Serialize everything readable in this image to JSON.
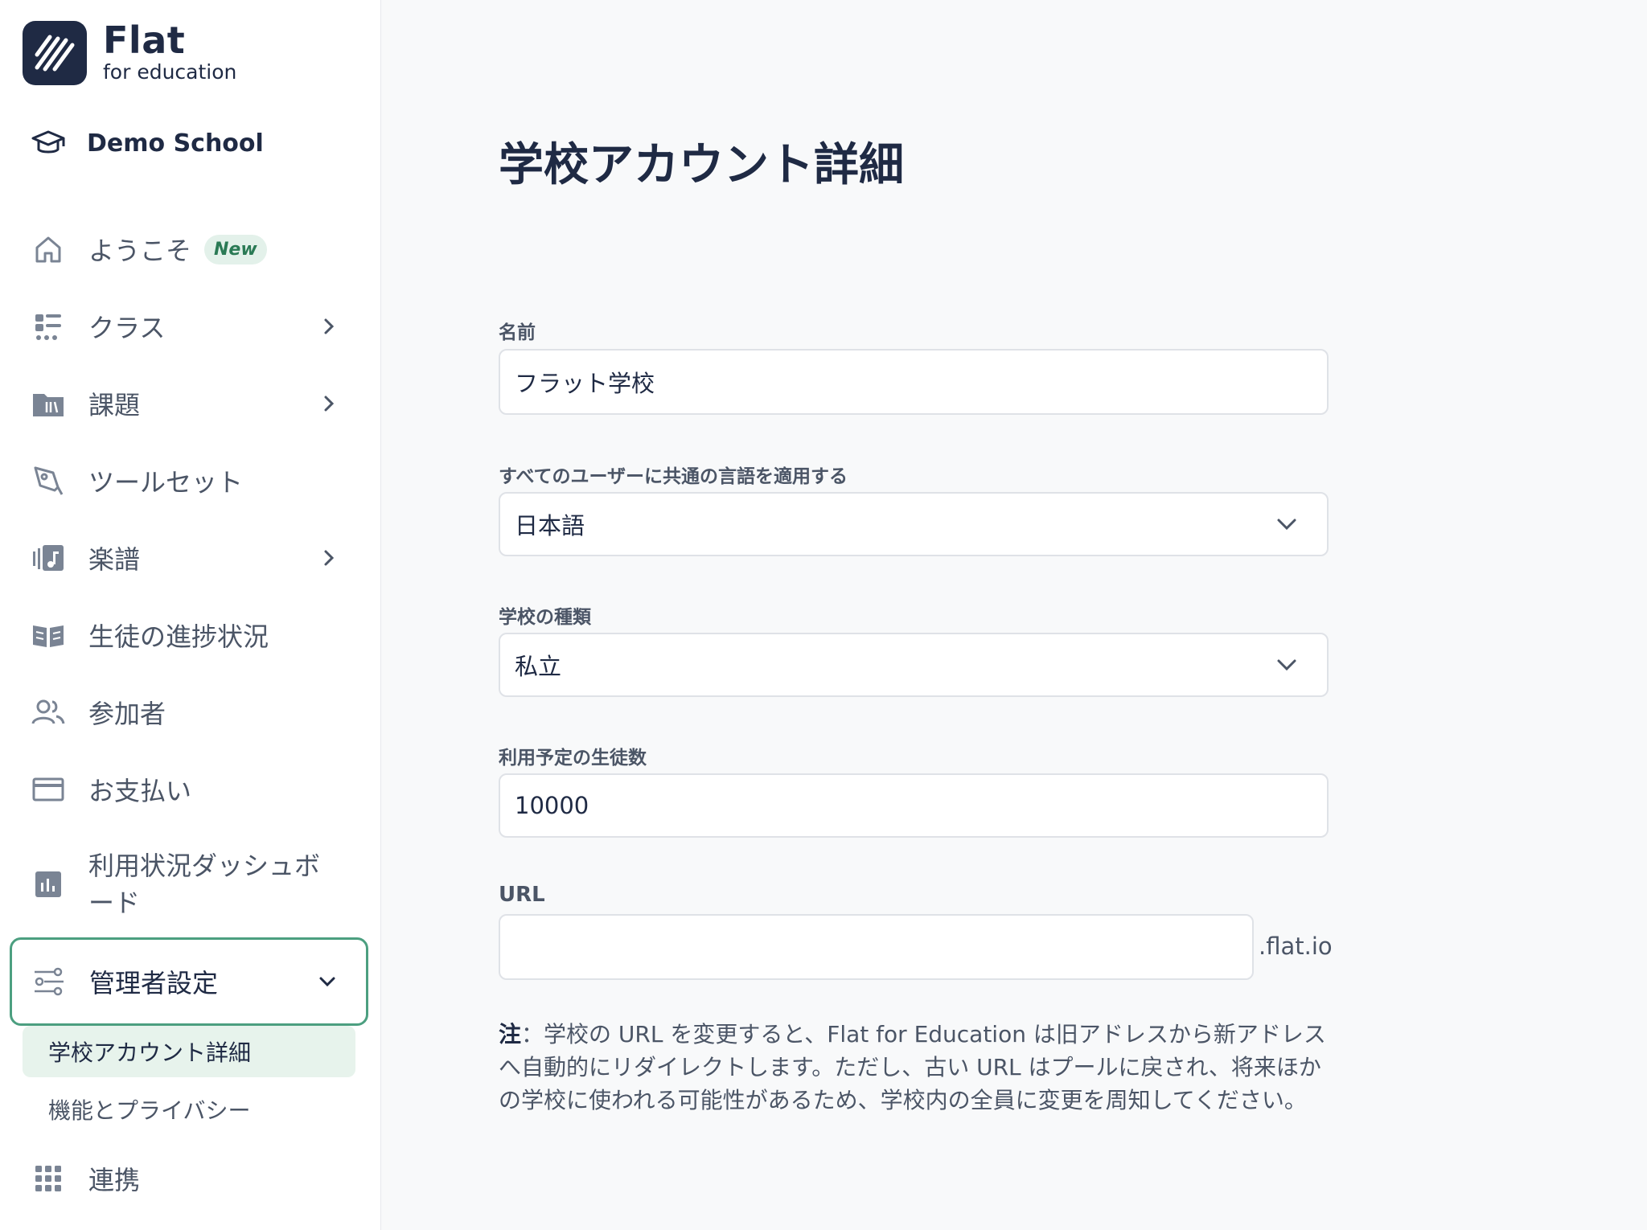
{
  "brand": {
    "name": "Flat",
    "tagline": "for education"
  },
  "school": {
    "name": "Demo School"
  },
  "sidebar": {
    "items": [
      {
        "label": "ようこそ",
        "badge": "New"
      },
      {
        "label": "クラス"
      },
      {
        "label": "課題"
      },
      {
        "label": "ツールセット"
      },
      {
        "label": "楽譜"
      },
      {
        "label": "生徒の進捗状況"
      },
      {
        "label": "参加者"
      },
      {
        "label": "お支払い"
      },
      {
        "label": "利用状況ダッシュボード"
      },
      {
        "label": "管理者設定"
      },
      {
        "label": "連携"
      }
    ],
    "admin_sub": [
      {
        "label": "学校アカウント詳細"
      },
      {
        "label": "機能とプライバシー"
      }
    ]
  },
  "main": {
    "title": "学校アカウント詳細",
    "fields": {
      "name": {
        "label": "名前",
        "value": "フラット学校"
      },
      "language": {
        "label": "すべてのユーザーに共通の言語を適用する",
        "value": "日本語"
      },
      "school_type": {
        "label": "学校の種類",
        "value": "私立"
      },
      "students": {
        "label": "利用予定の生徒数",
        "value": "10000"
      },
      "url": {
        "label": "URL",
        "value": "",
        "suffix": ".flat.io"
      }
    },
    "note": {
      "prefix": "注",
      "text": "：学校の URL を変更すると、Flat for Education は旧アドレスから新アドレスへ自動的にリダイレクトします。ただし、古い URL はプールに戻され、将来ほかの学校に使われる可能性があるため、学校内の全員に変更を周知してください。"
    }
  },
  "colors": {
    "accent": "#4c9f80",
    "navy": "#1f2a44",
    "selected_bg": "#e7f3ec"
  }
}
